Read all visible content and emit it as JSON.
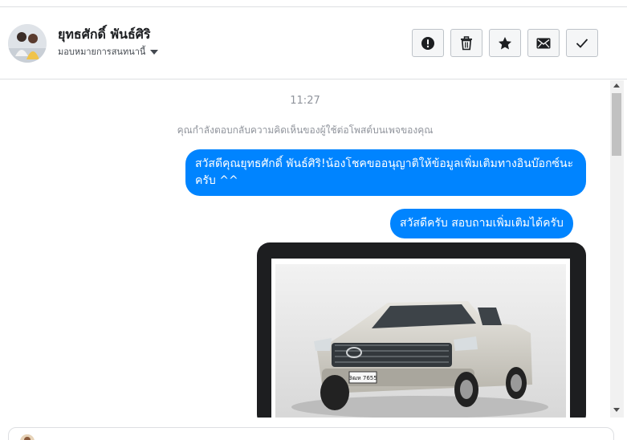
{
  "header": {
    "contact_name": "ยุทธศักดิ์ พันธ์ศิริ",
    "assign_label": "มอบหมายการสนทนานี้",
    "actions": [
      {
        "label": "Mark as spam",
        "icon": "exclamation-icon"
      },
      {
        "label": "Delete",
        "icon": "trash-icon"
      },
      {
        "label": "Star",
        "icon": "star-icon"
      },
      {
        "label": "Mark as unread",
        "icon": "envelope-icon"
      },
      {
        "label": "Mark as done",
        "icon": "check-icon"
      }
    ]
  },
  "thread": {
    "timestamp": "11:27",
    "notice": "คุณกำลังตอบกลับความคิดเห็นของผู้ใช้ต่อโพสต์บนเพจของคุณ",
    "messages": [
      {
        "text": "สวัสดีคุณยุทธศักดิ์ พันธ์ศิริ!น้องโชคขออนุญาติให้ข้อมูลเพิ่มเติมทางอินบ๊อกซ์นะครับ ^^",
        "sender": "page"
      },
      {
        "text": "สวัสดีครับ สอบถามเพิ่มเติมได้ครับ",
        "sender": "page"
      }
    ],
    "attachment": {
      "plate": "3ฒห 7655"
    }
  },
  "colors": {
    "bubble": "#0084ff",
    "card": "#1d1e20",
    "muted": "#90949c"
  }
}
